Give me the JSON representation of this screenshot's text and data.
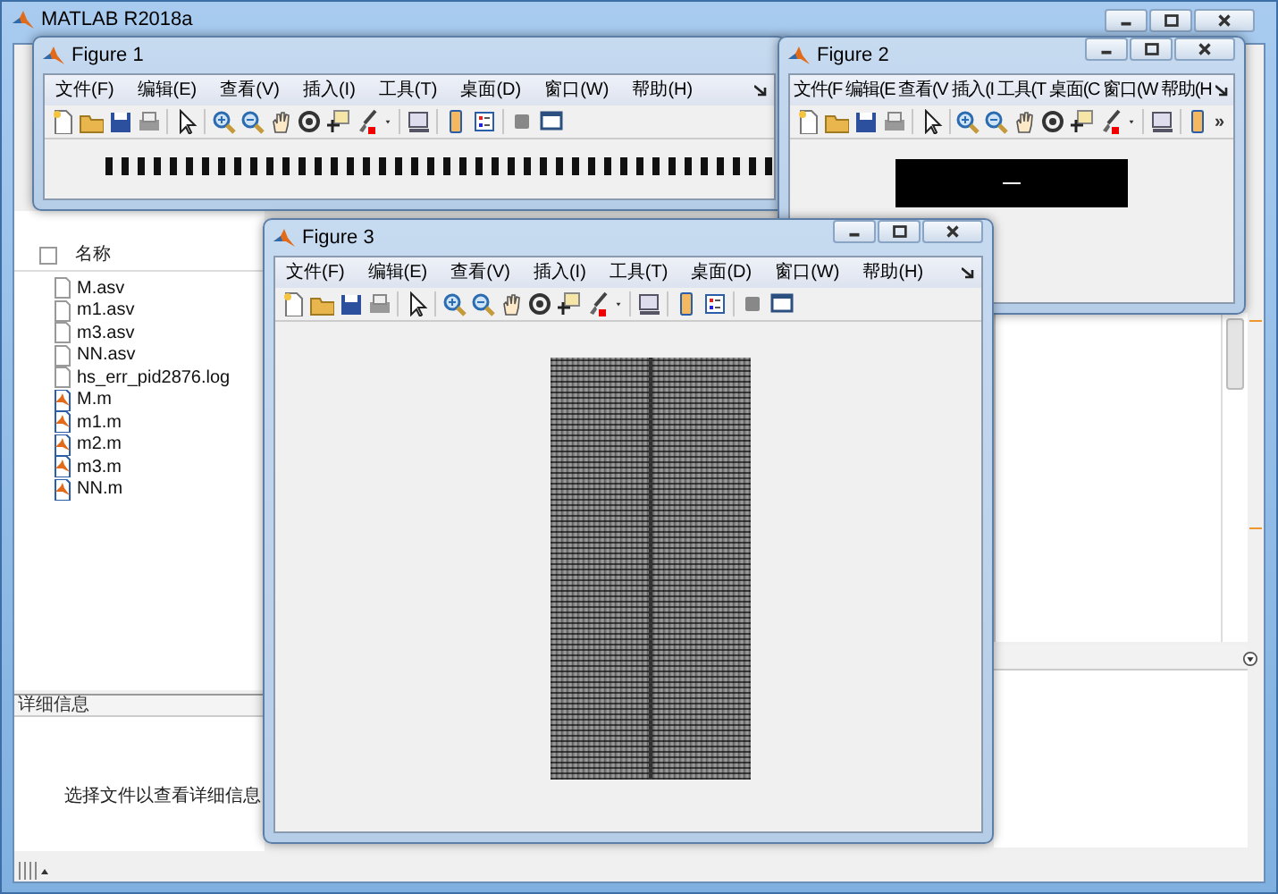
{
  "main_window": {
    "title": "MATLAB R2018a",
    "file_browser": {
      "column_header": "名称",
      "select_all_checked": false,
      "files": [
        {
          "name": "M.asv",
          "kind": "file"
        },
        {
          "name": "m1.asv",
          "kind": "file"
        },
        {
          "name": "m3.asv",
          "kind": "file"
        },
        {
          "name": "NN.asv",
          "kind": "file"
        },
        {
          "name": "hs_err_pid2876.log",
          "kind": "file"
        },
        {
          "name": "M.m",
          "kind": "script"
        },
        {
          "name": "m1.m",
          "kind": "script"
        },
        {
          "name": "m2.m",
          "kind": "script"
        },
        {
          "name": "m3.m",
          "kind": "script"
        },
        {
          "name": "NN.m",
          "kind": "script"
        }
      ]
    },
    "details": {
      "title": "详细信息",
      "message": "选择文件以查看详细信息"
    }
  },
  "figures": [
    {
      "title": "Figure 1",
      "menu": [
        "文件(F)",
        "编辑(E)",
        "查看(V)",
        "插入(I)",
        "工具(T)",
        "桌面(D)",
        "窗口(W)",
        "帮助(H)"
      ],
      "plot": {
        "kind": "dashes"
      }
    },
    {
      "title": "Figure 2",
      "menu": [
        "文件(F",
        "编辑(E",
        "查看(V",
        "插入(I",
        "工具(T",
        "桌面(C",
        "窗口(W",
        "帮助(H"
      ],
      "toolbar_overflow": "»",
      "plot": {
        "kind": "block"
      }
    },
    {
      "title": "Figure 3",
      "menu": [
        "文件(F)",
        "编辑(E)",
        "查看(V)",
        "插入(I)",
        "工具(T)",
        "桌面(D)",
        "窗口(W)",
        "帮助(H)"
      ],
      "plot": {
        "kind": "noise"
      }
    }
  ]
}
